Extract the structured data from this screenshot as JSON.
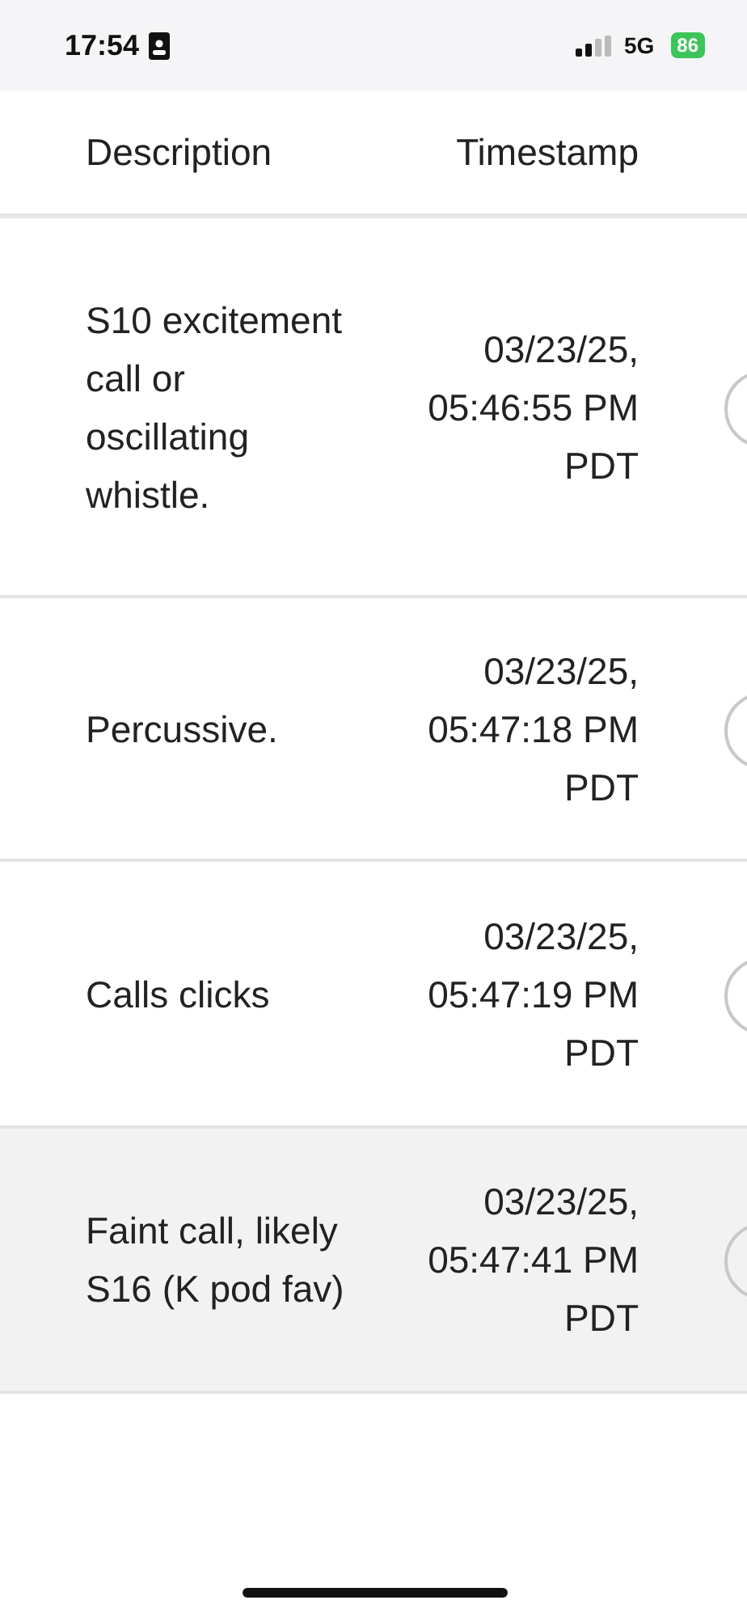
{
  "status_bar": {
    "time": "17:54",
    "network": "5G",
    "battery": "86"
  },
  "table": {
    "columns": [
      "Description",
      "Timestamp"
    ],
    "rows": [
      {
        "description": "S10 excitement call or oscillating whistle.",
        "timestamp": "03/23/25, 05:46:55 PM PDT",
        "highlighted": false
      },
      {
        "description": "Percussive.",
        "timestamp": "03/23/25, 05:47:18 PM PDT",
        "highlighted": false
      },
      {
        "description": "Calls clicks",
        "timestamp": "03/23/25, 05:47:19 PM PDT",
        "highlighted": false
      },
      {
        "description": "Faint call, likely S16 (K pod fav)",
        "timestamp": "03/23/25, 05:47:41 PM PDT",
        "highlighted": true
      }
    ]
  }
}
